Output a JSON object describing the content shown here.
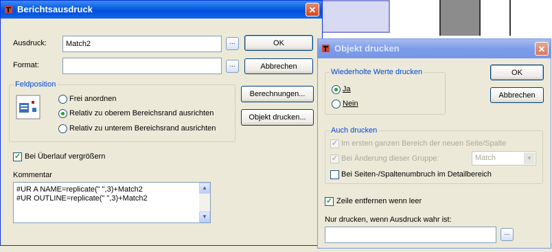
{
  "dialog1": {
    "title": "Berichtsausdruck",
    "ausdruck_label": "Ausdruck:",
    "ausdruck_value": "Match2",
    "format_label": "Format:",
    "format_value": "",
    "ellipsis": "...",
    "ok": "OK",
    "abbrechen": "Abbrechen",
    "berechnungen": "Berechnungen...",
    "objekt_drucken": "Objekt drucken...",
    "feldposition": {
      "legend": "Feldposition",
      "options": [
        "Frei anordnen",
        "Relativ zu oberem Bereichsrand ausrichten",
        "Relativ zu unterem Bereichsrand ausrichten"
      ],
      "selected_index": 1
    },
    "bei_ueberlauf": "Bei Überlauf vergrößern",
    "bei_ueberlauf_checked": true,
    "kommentar_label": "Kommentar",
    "kommentar_lines": [
      "#UR A NAME=replicate(\" \",3)+Match2",
      "#UR OUTLINE=replicate(\" \",3)+Match2"
    ]
  },
  "dialog2": {
    "title": "Objekt drucken",
    "wiederholte": {
      "legend": "Wiederholte Werte drucken",
      "options": [
        "Ja",
        "Nein"
      ],
      "selected_index": 0
    },
    "ok": "OK",
    "abbrechen": "Abbrechen",
    "auch_drucken": {
      "legend": "Auch drucken",
      "erster_bereich": "Im ersten ganzen Bereich der neuen Seite/Spalte",
      "aenderung_gruppe": "Bei Änderung dieser Gruppe:",
      "gruppe_value": "Match",
      "umbruch": "Bei Seiten-/Spaltenumbruch im Detailbereich"
    },
    "zeile_entfernen": "Zeile entfernen wenn leer",
    "zeile_entfernen_checked": true,
    "nur_drucken_label": "Nur drucken, wenn Ausdruck wahr ist:",
    "nur_drucken_value": "",
    "ellipsis": "..."
  },
  "colors": {
    "titlebar_active": "#0a5ce0",
    "titlebar_inactive": "#7c9ceb",
    "dialog_bg": "#ece9d8",
    "accent_text": "#0046d5"
  }
}
